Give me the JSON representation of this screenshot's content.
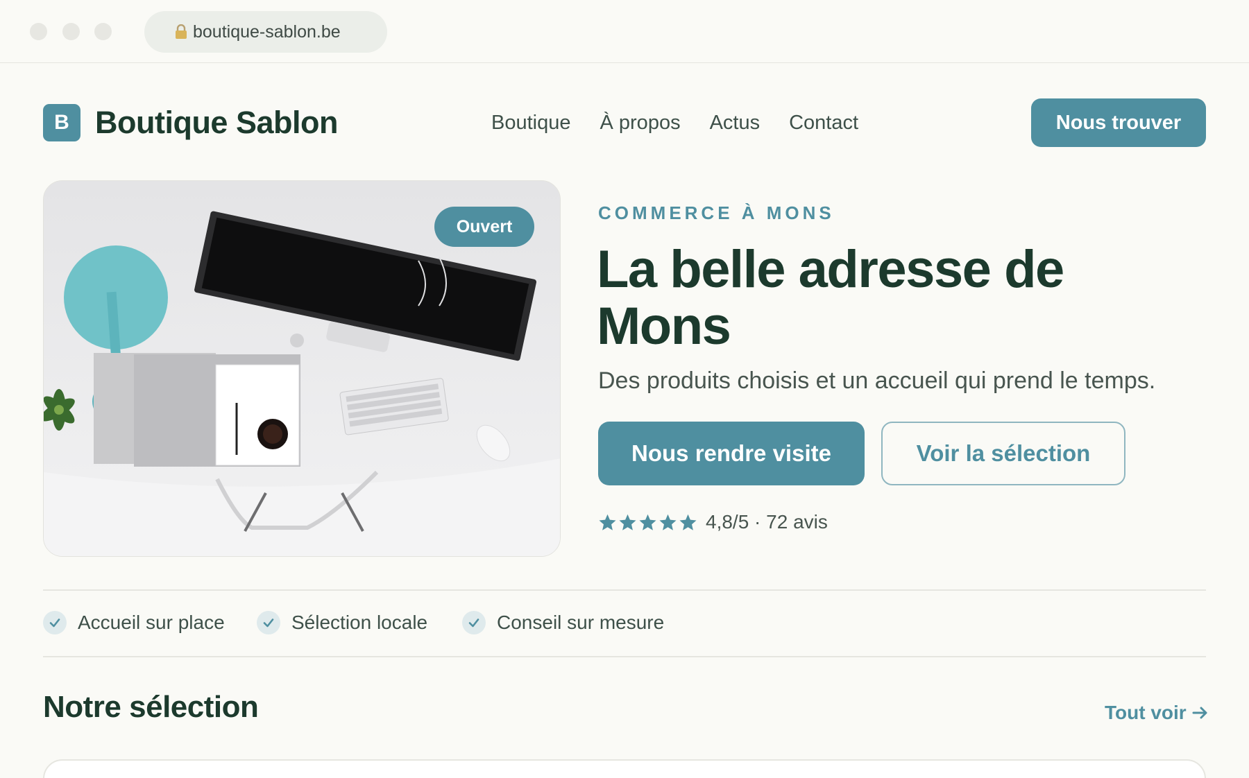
{
  "browser": {
    "url": "boutique-sablon.be",
    "lock_icon": "lock-icon"
  },
  "header": {
    "logo_letter": "B",
    "brand": "Boutique Sablon",
    "nav": [
      "Boutique",
      "À propos",
      "Actus",
      "Contact"
    ],
    "cta": "Nous trouver"
  },
  "hero": {
    "badge": "Ouvert",
    "eyebrow": "COMMERCE À MONS",
    "title": "La belle adresse de Mons",
    "subtitle": "Des produits choisis et un accueil qui prend le temps.",
    "primary_button": "Nous rendre visite",
    "secondary_button": "Voir la sélection",
    "rating": {
      "stars": 5,
      "text": "4,8/5 · 72 avis"
    }
  },
  "features": [
    "Accueil sur place",
    "Sélection locale",
    "Conseil sur mesure"
  ],
  "section": {
    "title": "Notre sélection",
    "link": "Tout voir"
  },
  "colors": {
    "accent": "#4f8fa0",
    "heading": "#1c3a2d",
    "background": "#fafaf6"
  }
}
